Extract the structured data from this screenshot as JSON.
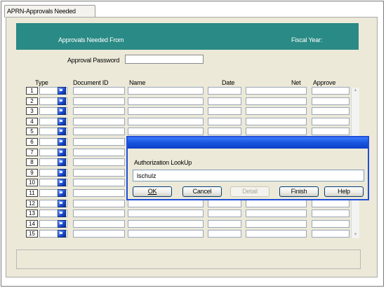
{
  "tab": {
    "label": "APRN-Approvals Needed"
  },
  "header": {
    "approvals_from": "Approvals Needed From",
    "fiscal_year": "Fiscal Year:"
  },
  "password": {
    "label": "Approval Password",
    "value": ""
  },
  "columns": {
    "type": "Type",
    "document_id": "Document ID",
    "name": "Name",
    "date": "Date",
    "net": "Net",
    "approve": "Approve"
  },
  "rows": [
    "1",
    "2",
    "3",
    "4",
    "5",
    "6",
    "7",
    "8",
    "9",
    "10",
    "11",
    "12",
    "13",
    "14",
    "15"
  ],
  "dialog": {
    "label": "Authorization LookUp",
    "value": "lschulz",
    "buttons": {
      "ok": "OK",
      "cancel": "Cancel",
      "detail": "Detail",
      "finish": "Finish",
      "help": "Help"
    }
  },
  "colors": {
    "header_bg": "#2a8a85",
    "dialog_title": "#1a56e0",
    "window_bg": "#ece9d8"
  },
  "icons": {
    "type_cell": "document-type-icon"
  }
}
